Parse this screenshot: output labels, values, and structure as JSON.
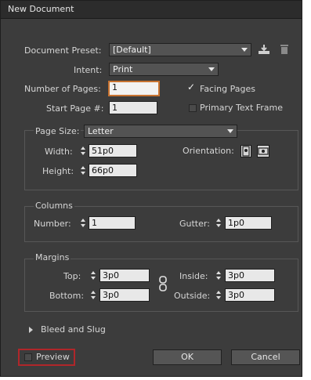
{
  "window": {
    "title": "New Document"
  },
  "preset": {
    "label": "Document Preset:",
    "value": "[Default]"
  },
  "intent": {
    "label": "Intent:",
    "value": "Print"
  },
  "pages": {
    "number_label": "Number of Pages:",
    "number_value": "1",
    "start_label": "Start Page #:",
    "start_value": "1",
    "facing_label": "Facing Pages",
    "facing_checked": true,
    "primary_label": "Primary Text Frame",
    "primary_checked": false
  },
  "page_size": {
    "label": "Page Size:",
    "value": "Letter",
    "width_label": "Width:",
    "width_value": "51p0",
    "height_label": "Height:",
    "height_value": "66p0",
    "orientation_label": "Orientation:"
  },
  "columns": {
    "group_label": "Columns",
    "number_label": "Number:",
    "number_value": "1",
    "gutter_label": "Gutter:",
    "gutter_value": "1p0"
  },
  "margins": {
    "group_label": "Margins",
    "top_label": "Top:",
    "top_value": "3p0",
    "bottom_label": "Bottom:",
    "bottom_value": "3p0",
    "inside_label": "Inside:",
    "inside_value": "3p0",
    "outside_label": "Outside:",
    "outside_value": "3p0"
  },
  "bleed": {
    "label": "Bleed and Slug"
  },
  "footer": {
    "preview_label": "Preview",
    "ok_label": "OK",
    "cancel_label": "Cancel"
  },
  "colors": {
    "dialog_bg": "#3c3c3c",
    "focus": "#c87331",
    "highlight": "#b0262a"
  }
}
